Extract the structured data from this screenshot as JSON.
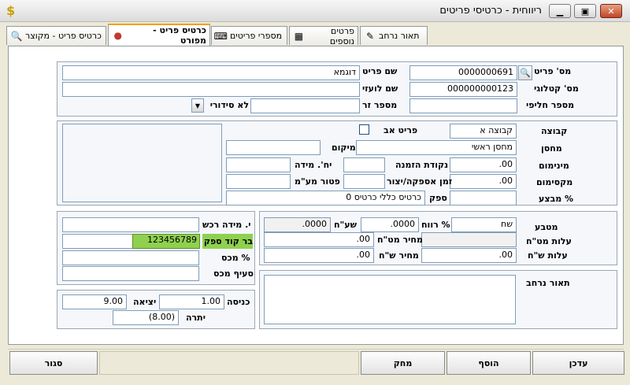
{
  "window": {
    "title": "ריווחית - כרטיסי פריטים",
    "app_icon": "$",
    "minimize": "▁",
    "maximize": "▣",
    "close": "✕"
  },
  "tabs": [
    {
      "label": "תאור נרחב",
      "icon": "edit-icon"
    },
    {
      "label": "פרטים נוספים",
      "icon": "grid-icon"
    },
    {
      "label": "מספרי פריטים",
      "icon": "keyboard-icon"
    },
    {
      "label": "כרטיס פריט - מפורט",
      "icon": "color-balls-icon",
      "active": true
    },
    {
      "label": "כרטיס פריט - מקוצר",
      "icon": "search-card-icon"
    }
  ],
  "identity": {
    "item_no_label": "מס' פריט",
    "item_no": "0000000691",
    "catalog_no_label": "מס' קטלוגי",
    "catalog_no": "000000000123",
    "spare_no_label": "מספר חליפי",
    "spare_no": "",
    "item_name_label": "שם פריט",
    "item_name": "דוגמא",
    "foreign_name_label": "שם לועזי",
    "foreign_name": "",
    "serial_label": "מספר זר",
    "serial_value": "",
    "serial_type": "לא סידורי",
    "dd_arrow": "▼"
  },
  "stock": {
    "group_label": "קבוצה",
    "group_value": "קבוצה א",
    "parent_label": "פריט אב",
    "warehouse_label": "מחסן",
    "warehouse_value": "מחסן ראשי",
    "location_label": "מיקום",
    "location_value": "",
    "min_label": "מינימום",
    "min_value": ".00",
    "reorder_label": "נקודת הזמנה",
    "reorder_value": "",
    "unit_label": "יח'. מידה",
    "unit_value": "",
    "max_label": "מקסימום",
    "max_value": ".00",
    "lead_label": "זמן אספקה/יצור",
    "lead_value": "",
    "vat_exempt_label": "פטור מע\"מ",
    "vat_exempt_value": "",
    "promo_label": "% מבצע",
    "promo_value": "",
    "supplier_label": "ספק",
    "supplier_value": "כרטיס כללי כרטיס 0"
  },
  "purchase": {
    "unit_label": "י. מידה רכש",
    "unit_value": "",
    "barcode_label": "בר קוד ספק",
    "barcode_value": "123456789",
    "tax_pct_label": "% מכס",
    "tax_pct_value": "",
    "tax_clause_label": "סעיף מכס",
    "tax_clause_value": ""
  },
  "pricing": {
    "currency_label": "מטבע",
    "currency_value": "שח",
    "profit_label": "% רווח",
    "profit_value": ".0000",
    "rate_label": "שע\"ח",
    "rate_value": ".0000",
    "cost_vat_label": "עלות מט\"ח",
    "cost_vat_value": "",
    "price_vat_label": "מחיר מט\"ח",
    "price_vat_value": ".00",
    "cost_nis_label": "עלות ש\"ח",
    "cost_nis_value": ".00",
    "price_nis_label": "מחיר ש\"ח",
    "price_nis_value": ".00"
  },
  "conversion": {
    "in_label": "כניסה",
    "in_value": "1.00",
    "out_label": "יציאה",
    "out_value": "9.00",
    "balance_label": "יתרה",
    "balance_value": "(8.00)"
  },
  "description": {
    "label": "תאור נרחב",
    "value": ""
  },
  "buttons": {
    "update": "עדכן",
    "add": "הוסף",
    "delete": "מחק",
    "close": "סגור"
  }
}
